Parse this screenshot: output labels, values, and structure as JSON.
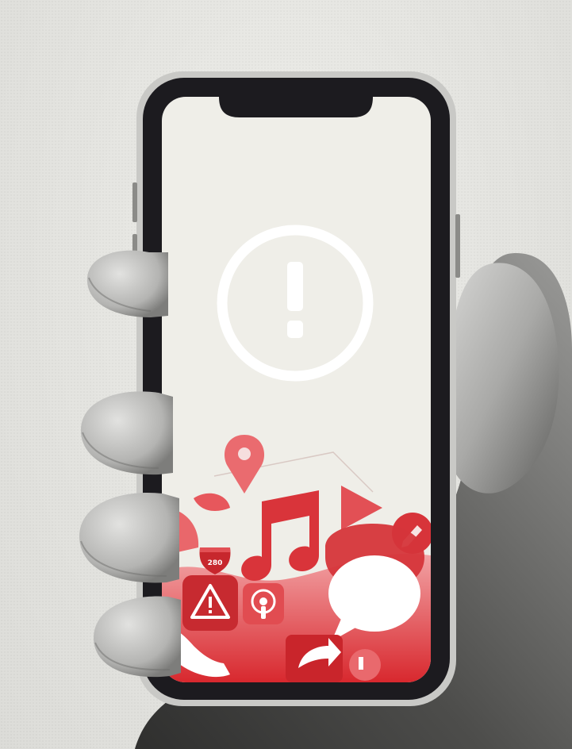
{
  "image": {
    "subject": "hand-holding-smartphone",
    "screen_icon": "exclamation-circle-icon",
    "background_color": "#e6e6e3",
    "screen_color": "#efeee8",
    "accent_color": "#e03a3f",
    "phone_frame_color": "#1c1b1f"
  },
  "screen": {
    "app_icons": [
      "map-pin-icon",
      "music-note-icon",
      "play-triangle-icon",
      "pencil-badge-icon",
      "highway-shield-icon",
      "warning-triangle-icon",
      "podcast-icon",
      "phone-handset-icon",
      "chat-bubble-icon",
      "share-arrow-icon"
    ],
    "highway_shield_number": "280"
  }
}
